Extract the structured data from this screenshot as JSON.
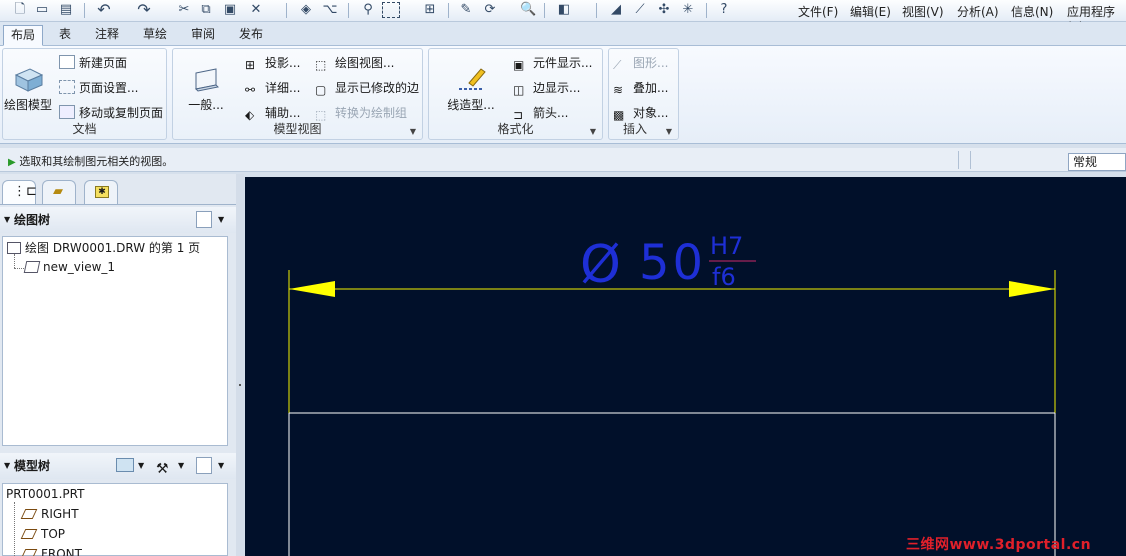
{
  "menubar": {
    "items": [
      "文件(F)",
      "编辑(E)",
      "视图(V)",
      "分析(A)",
      "信息(N)",
      "应用程序(P)"
    ]
  },
  "tabs": [
    "布局",
    "表",
    "注释",
    "草绘",
    "审阅",
    "发布"
  ],
  "ribbon": {
    "document": {
      "big_label": "绘图模型",
      "items": [
        "新建页面",
        "页面设置...",
        "移动或复制页面"
      ],
      "label": "文档"
    },
    "model_view": {
      "big_label": "一般...",
      "col1": [
        "投影...",
        "详细...",
        "辅助..."
      ],
      "col2": [
        "绘图视图...",
        "显示已修改的边",
        "转换为绘制组"
      ],
      "label": "模型视图"
    },
    "format": {
      "big_label": "线造型...",
      "items": [
        "元件显示...",
        "边显示...",
        "箭头..."
      ],
      "label": "格式化"
    },
    "insert": {
      "items": [
        "图形...",
        "叠加...",
        "对象..."
      ],
      "label": "插入"
    }
  },
  "status": {
    "message": "选取和其绘制图元相关的视图。",
    "filter_value": "常规"
  },
  "drawing_tree": {
    "title": "绘图树",
    "items": [
      "绘图 DRW0001.DRW 的第 1 页",
      "new_view_1"
    ]
  },
  "model_tree": {
    "title": "模型树",
    "items": [
      "PRT0001.PRT",
      "RIGHT",
      "TOP",
      "FRONT"
    ]
  },
  "canvas": {
    "dimension": {
      "symbol": "Ø",
      "value": "50",
      "upper": "H7",
      "lower": "f6"
    },
    "colors": {
      "background": "#01102a",
      "dimension_text": "#1e2fd6",
      "dimension_line": "#f2f200",
      "arrows": "#ffff00",
      "geometry": "#ffffff"
    }
  },
  "watermark": "三维网www.3dportal.cn"
}
